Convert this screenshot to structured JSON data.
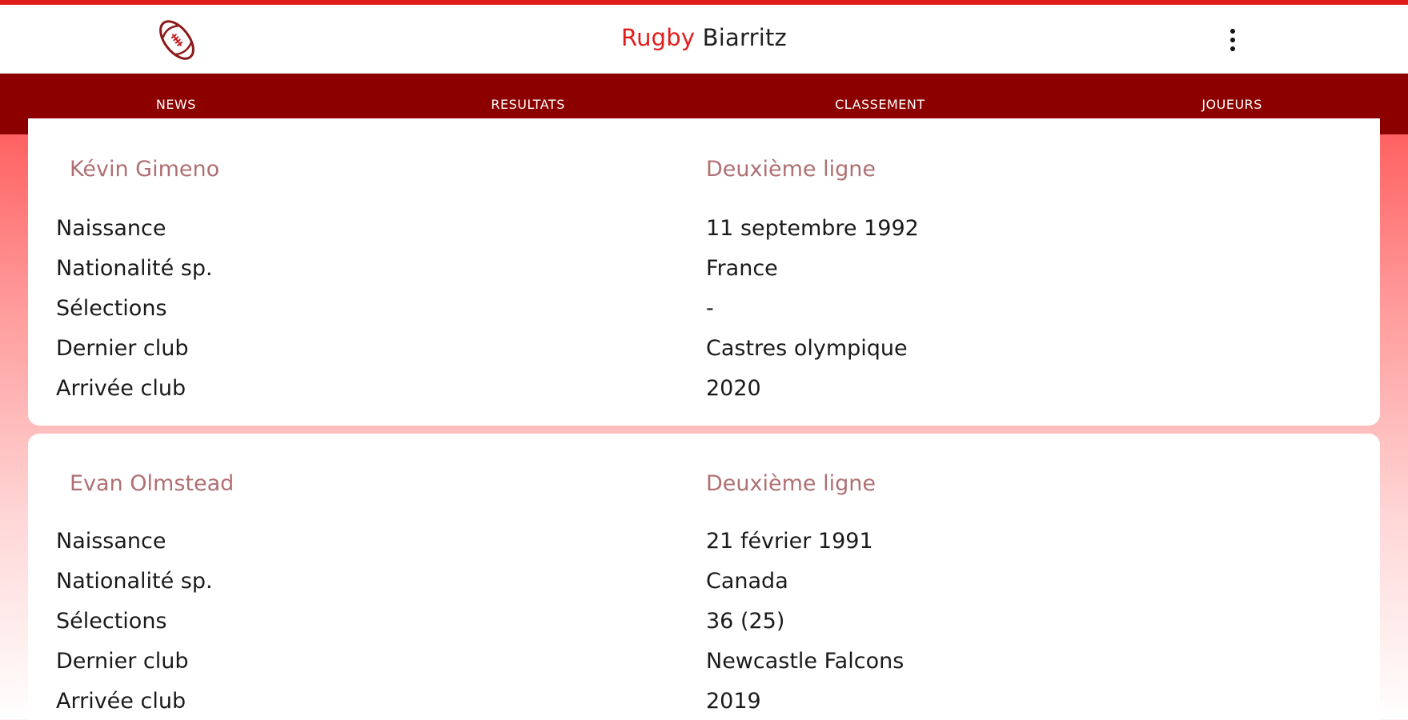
{
  "app": {
    "title_accent": "Rugby",
    "title_rest": " Biarritz"
  },
  "icons": {
    "logo": "rugby-ball-icon",
    "menu": "more-vertical-icon"
  },
  "colors": {
    "accent": "#e21b1b",
    "nav_bar": "#8c0000",
    "player_name": "#b07073"
  },
  "tabs": [
    {
      "label": "NEWS"
    },
    {
      "label": "RESULTATS"
    },
    {
      "label": "CLASSEMENT"
    },
    {
      "label": "JOUEURS"
    }
  ],
  "players": [
    {
      "name": "Kévin Gimeno",
      "position": "Deuxième ligne",
      "fields": [
        {
          "label": "Naissance",
          "value": "11 septembre 1992"
        },
        {
          "label": "Nationalité sp.",
          "value": "France"
        },
        {
          "label": "Sélections",
          "value": "-"
        },
        {
          "label": "Dernier club",
          "value": "Castres olympique"
        },
        {
          "label": "Arrivée club",
          "value": "2020"
        }
      ]
    },
    {
      "name": "Evan Olmstead",
      "position": "Deuxième ligne",
      "fields": [
        {
          "label": "Naissance",
          "value": "21 février 1991"
        },
        {
          "label": "Nationalité sp.",
          "value": "Canada"
        },
        {
          "label": "Sélections",
          "value": "36 (25)"
        },
        {
          "label": "Dernier club",
          "value": "Newcastle Falcons"
        },
        {
          "label": "Arrivée club",
          "value": "2019"
        }
      ]
    }
  ]
}
